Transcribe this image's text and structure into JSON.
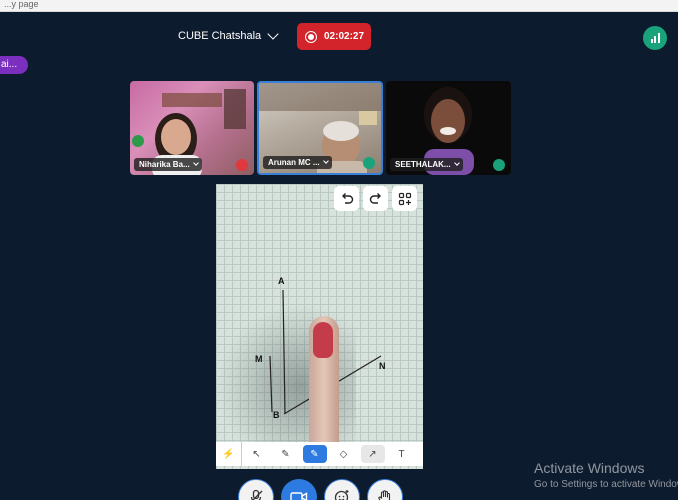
{
  "browser": {
    "tab_fragment": "...y page"
  },
  "header": {
    "meeting_name": "CUBE Chatshala",
    "recording_time": "02:02:27"
  },
  "side_chip": {
    "label": "ai..."
  },
  "participants": [
    {
      "name": "Niharika Ba...",
      "mic": "muted"
    },
    {
      "name": "Arunan MC ...",
      "mic": "active"
    },
    {
      "name": "SEETHALAK...",
      "mic": "active"
    }
  ],
  "whiteboard": {
    "points": {
      "a": "A",
      "m": "M",
      "b": "B",
      "n": "N"
    },
    "controls": [
      "undo-icon",
      "redo-icon",
      "add-widgets-icon"
    ],
    "tools": [
      {
        "name": "laser",
        "glyph": "⚡"
      },
      {
        "name": "select",
        "glyph": "↖"
      },
      {
        "name": "pen",
        "glyph": "✎"
      },
      {
        "name": "marker",
        "glyph": "✎"
      },
      {
        "name": "eraser",
        "glyph": "◇"
      },
      {
        "name": "arrow",
        "glyph": "↗"
      },
      {
        "name": "text",
        "glyph": "T"
      }
    ],
    "active_tool": "marker"
  },
  "bottom_bar": [
    "mic-off-icon",
    "camera-icon",
    "reactions-icon",
    "raise-hand-icon"
  ],
  "watermark": {
    "title": "Activate Windows",
    "subtitle": "Go to Settings to activate Windows."
  },
  "colors": {
    "record": "#d3242c",
    "accent": "#2d7be0",
    "signal": "#1aa37a",
    "chip": "#7b2fbf",
    "background": "#0d1b2e"
  }
}
